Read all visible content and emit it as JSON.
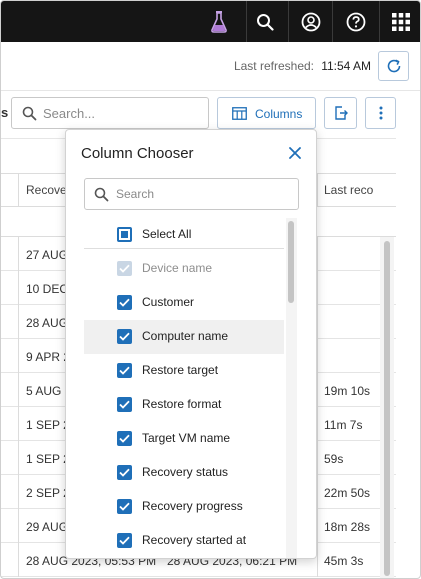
{
  "topbar": {
    "icons": [
      "flask-icon",
      "search-icon",
      "user-icon",
      "help-icon",
      "apps-grid-icon"
    ]
  },
  "refresh": {
    "label": "Last refreshed:",
    "time": "11:54 AM"
  },
  "toolbar": {
    "stub_text": "s",
    "search_placeholder": "Search...",
    "columns_label": "Columns"
  },
  "table": {
    "headers": [
      "Recove",
      "Last reco"
    ],
    "rows": [
      {
        "start": "27 AUG",
        "last": ""
      },
      {
        "start": "10 DEC",
        "last": ""
      },
      {
        "start": "28 AUG",
        "last": ""
      },
      {
        "start": "9 APR 2",
        "last": ""
      },
      {
        "start": "5 AUG 2",
        "last": "19m 10s"
      },
      {
        "start": "1 SEP 2",
        "last": "11m 7s"
      },
      {
        "start": "1 SEP 2",
        "last": "59s"
      },
      {
        "start": "2 SEP 2",
        "last": "22m 50s"
      },
      {
        "start": "29 AUG",
        "last": "18m 28s"
      },
      {
        "start": "28 AUG 2023, 05:53 PM",
        "mid": "28 AUG 2023, 06:21 PM",
        "last": "45m 3s"
      }
    ]
  },
  "column_chooser": {
    "title": "Column Chooser",
    "search_placeholder": "Search",
    "select_all": "Select All",
    "items": [
      {
        "label": "Device name",
        "state": "disabled"
      },
      {
        "label": "Customer",
        "state": "checked"
      },
      {
        "label": "Computer name",
        "state": "checked"
      },
      {
        "label": "Restore target",
        "state": "checked"
      },
      {
        "label": "Restore format",
        "state": "checked"
      },
      {
        "label": "Target VM name",
        "state": "checked"
      },
      {
        "label": "Recovery status",
        "state": "checked"
      },
      {
        "label": "Recovery progress",
        "state": "checked"
      },
      {
        "label": "Recovery started at",
        "state": "checked"
      }
    ]
  },
  "colors": {
    "accent": "#1f6fb8",
    "topbar_bg": "#151515",
    "flask": "#b07ad6"
  }
}
